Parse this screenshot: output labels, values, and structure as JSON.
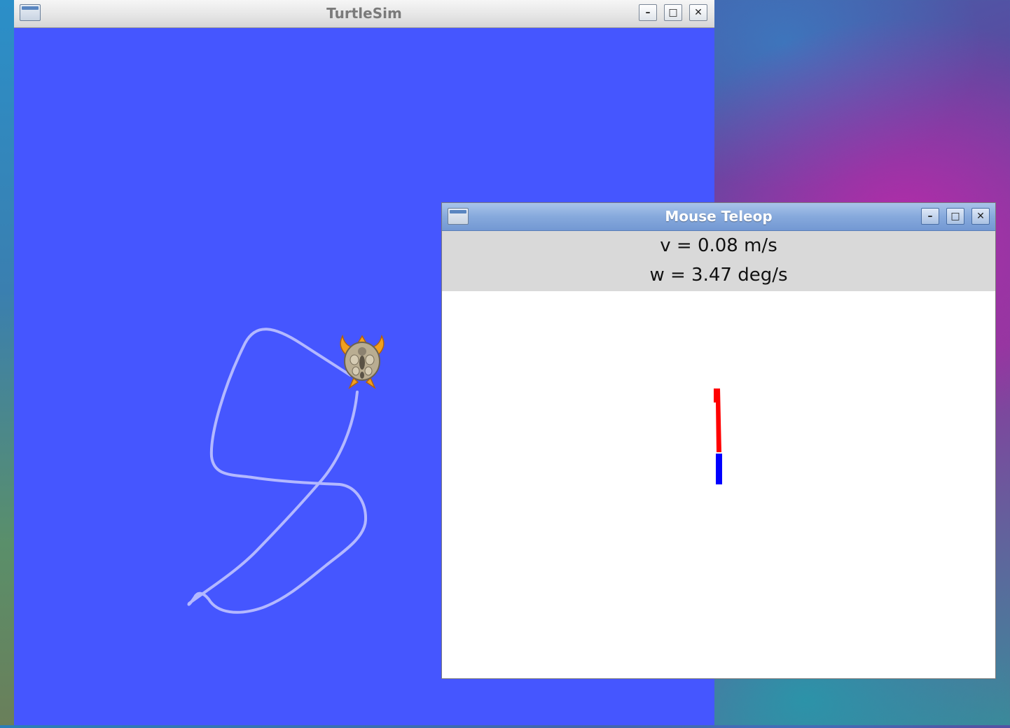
{
  "desktop": {
    "name": "desktop-background"
  },
  "turtlesim": {
    "title": "TurtleSim",
    "buttons": {
      "minimize": "–",
      "maximize": "□",
      "close": "✕"
    },
    "background_color": "#4556ff",
    "pen_color": "#b3b8ff"
  },
  "mouse_teleop": {
    "title": "Mouse Teleop",
    "linear_velocity": "v = 0.08 m/s",
    "angular_velocity": "w = 3.47 deg/s",
    "buttons": {
      "minimize": "–",
      "maximize": "□",
      "close": "✕"
    },
    "linear_indicator_color": "#ff0000",
    "angular_indicator_color": "#0000ff"
  }
}
